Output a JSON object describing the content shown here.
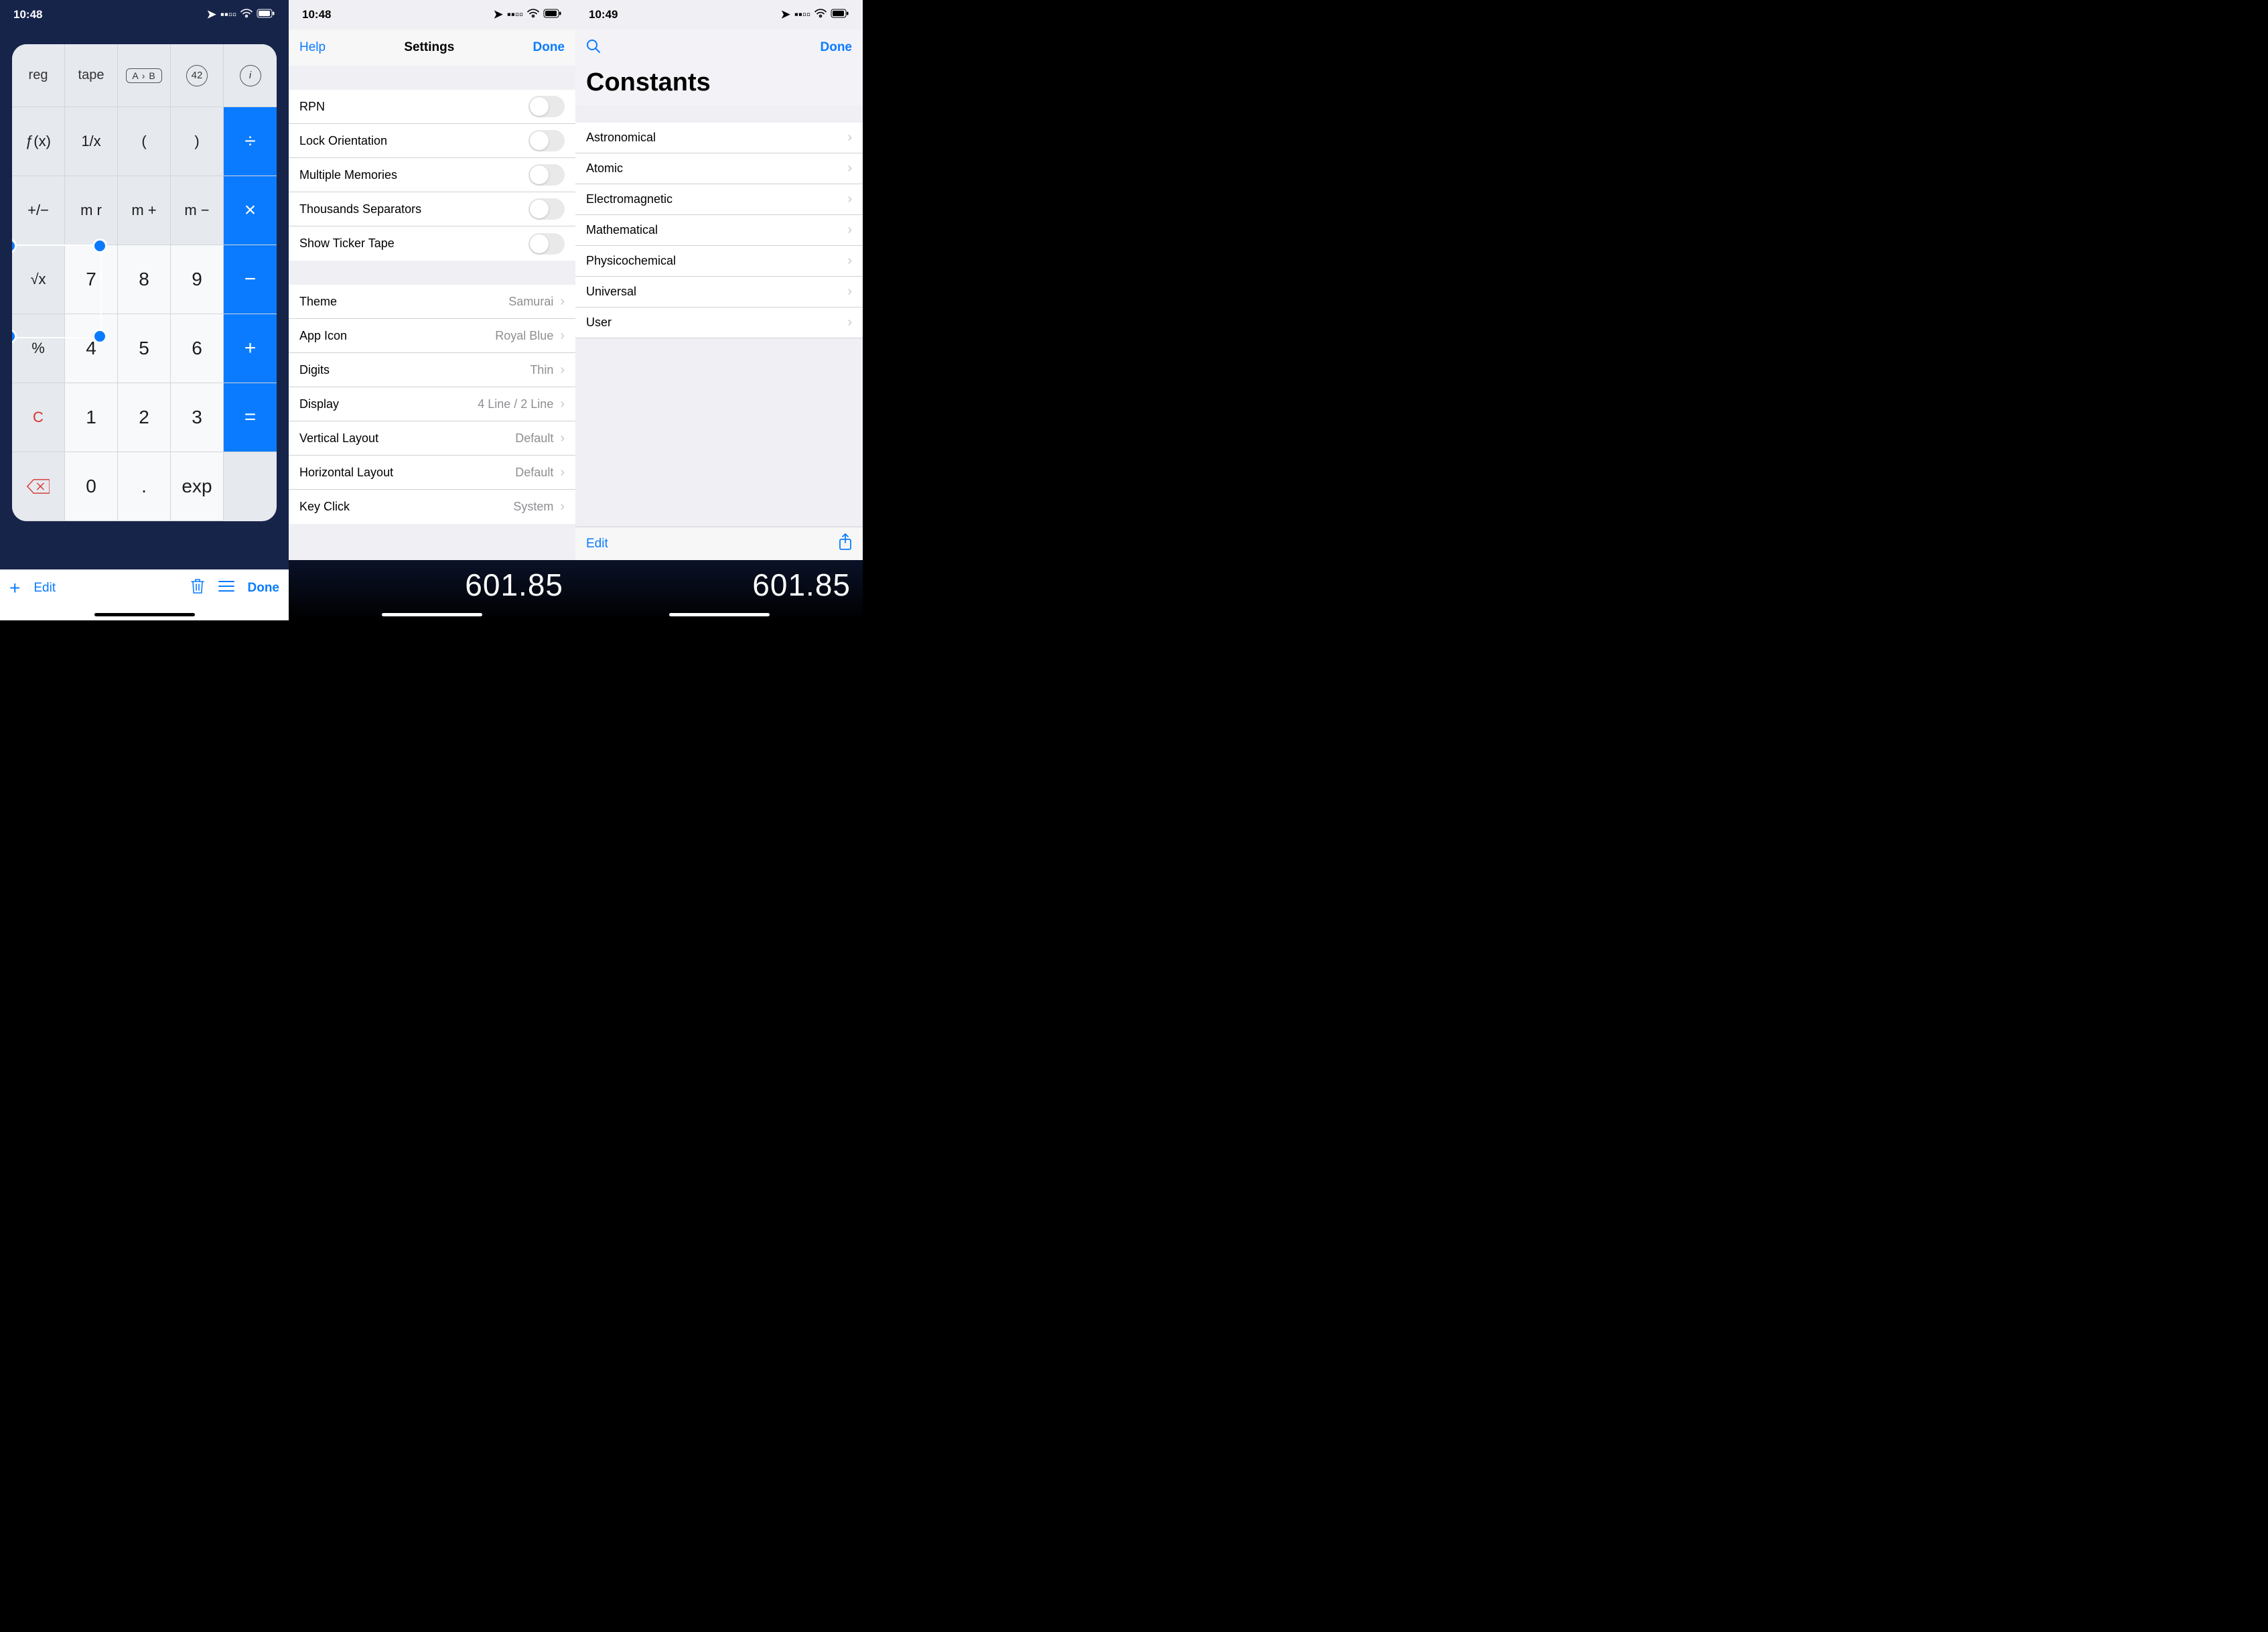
{
  "pane1": {
    "status_time": "10:48",
    "keys_top": [
      "reg",
      "tape",
      "A › B",
      "42",
      "i"
    ],
    "row2": [
      "ƒ(x)",
      "1/x",
      "(",
      ")",
      "÷"
    ],
    "row3": [
      "+/−",
      "m r",
      "m +",
      "m −",
      "×"
    ],
    "row4": [
      "√x",
      "7",
      "8",
      "9",
      "−"
    ],
    "row5": [
      "%",
      "4",
      "5",
      "6",
      "+"
    ],
    "row6": [
      "C",
      "1",
      "2",
      "3",
      "="
    ],
    "row7": [
      "⌫",
      "0",
      ".",
      "exp"
    ],
    "toolbar": {
      "add": "+",
      "edit": "Edit",
      "done": "Done"
    }
  },
  "pane2": {
    "status_time": "10:48",
    "nav": {
      "help": "Help",
      "title": "Settings",
      "done": "Done"
    },
    "toggles": [
      {
        "label": "RPN"
      },
      {
        "label": "Lock Orientation"
      },
      {
        "label": "Multiple Memories"
      },
      {
        "label": "Thousands Separators"
      },
      {
        "label": "Show Ticker Tape"
      }
    ],
    "options": [
      {
        "label": "Theme",
        "value": "Samurai"
      },
      {
        "label": "App Icon",
        "value": "Royal Blue"
      },
      {
        "label": "Digits",
        "value": "Thin"
      },
      {
        "label": "Display",
        "value": "4 Line / 2 Line"
      },
      {
        "label": "Vertical Layout",
        "value": "Default"
      },
      {
        "label": "Horizontal Layout",
        "value": "Default"
      },
      {
        "label": "Key Click",
        "value": "System"
      }
    ],
    "display_value": "601.85"
  },
  "pane3": {
    "status_time": "10:49",
    "nav_done": "Done",
    "title": "Constants",
    "categories": [
      "Astronomical",
      "Atomic",
      "Electromagnetic",
      "Mathematical",
      "Physicochemical",
      "Universal",
      "User"
    ],
    "toolbar": {
      "edit": "Edit"
    },
    "display_value": "601.85"
  }
}
